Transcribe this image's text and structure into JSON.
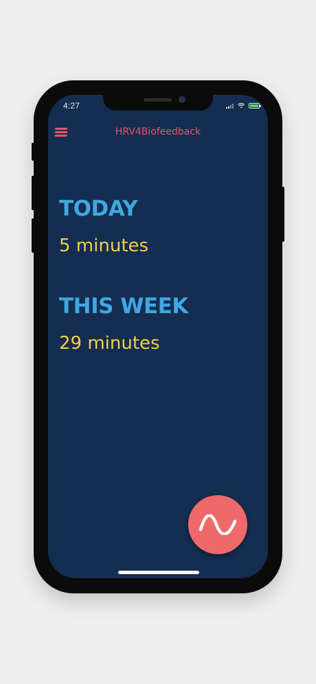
{
  "status_bar": {
    "time": "4:27"
  },
  "nav": {
    "title": "HRV4Biofeedback",
    "menu_icon": "hamburger-icon"
  },
  "today": {
    "heading": "TODAY",
    "value": "5 minutes"
  },
  "this_week": {
    "heading": "THIS WEEK",
    "value": "29 minutes"
  },
  "fab": {
    "icon": "wave-icon"
  },
  "colors": {
    "background": "#152d50",
    "accent": "#e8546a",
    "heading": "#3fa8e2",
    "value": "#f2cf48",
    "fab": "#ee6a6a"
  }
}
